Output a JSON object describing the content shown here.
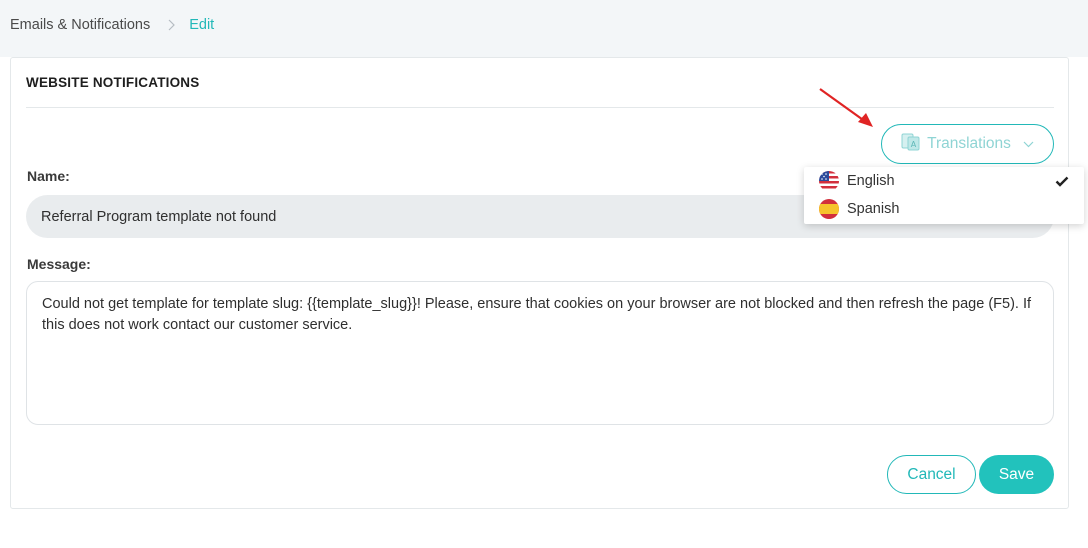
{
  "breadcrumb": {
    "root": "Emails & Notifications",
    "current": "Edit"
  },
  "card": {
    "title": "WEBSITE NOTIFICATIONS"
  },
  "translations": {
    "label": "Translations",
    "icon": "translate-icon",
    "options": [
      {
        "label": "English",
        "flag": "us-flag-icon",
        "selected": true
      },
      {
        "label": "Spanish",
        "flag": "spain-flag-icon",
        "selected": false
      }
    ]
  },
  "form": {
    "name_label": "Name:",
    "name_value": "Referral Program template not found",
    "message_label": "Message:",
    "message_value": "Could not get template for template slug:  {{template_slug}}! Please, ensure that cookies on your browser are not blocked and then refresh the page (F5). If this does not work contact our customer service."
  },
  "actions": {
    "cancel_label": "Cancel",
    "save_label": "Save"
  },
  "colors": {
    "accent": "#22b8b8",
    "save_bg": "#22c2bc",
    "annotation_arrow": "#e02424"
  }
}
